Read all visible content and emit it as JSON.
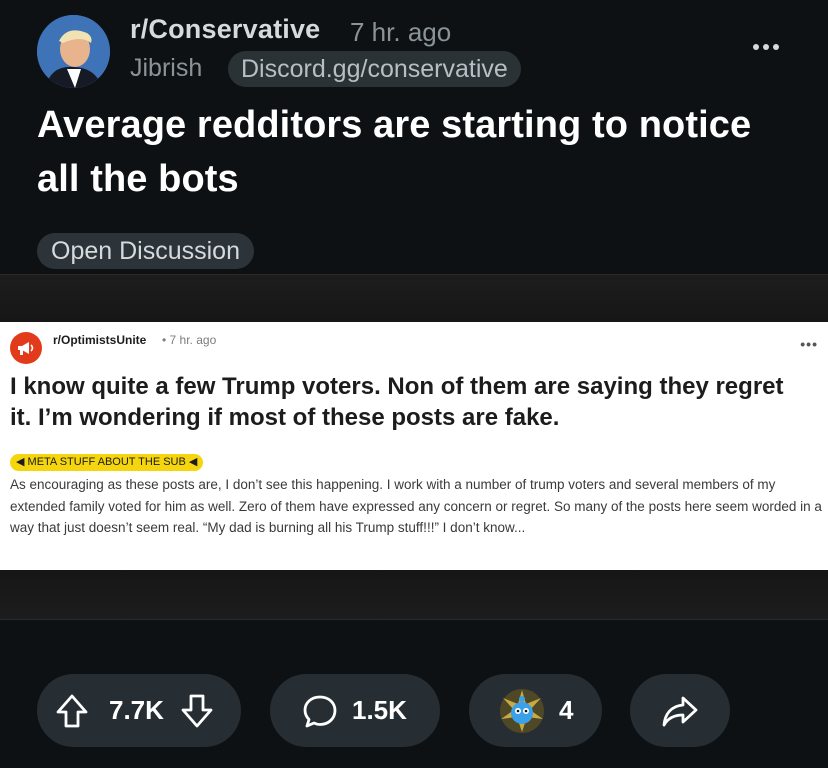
{
  "post": {
    "subreddit": "r/Conservative",
    "time": "7 hr. ago",
    "user_flair": "Jibrish",
    "user_link": "Discord.gg/conservative",
    "title": "Average redditors are starting to notice all the bots",
    "post_flair": "Open Discussion"
  },
  "image": {
    "subreddit": "r/OptimistsUnite",
    "time": "• 7 hr. ago",
    "more": "•••",
    "title": "I know quite a few Trump voters. Non of them are saying they regret it. I’m wondering if most of these posts are fake.",
    "flair": "META STUFF ABOUT THE SUB",
    "body": "As encouraging as these posts are, I don’t see this happening. I work with a number of trump voters and several members of my extended family voted for him as well. Zero of them have expressed any concern or regret. So many of the posts here seem worded in a way that just doesn’t seem real. “My dad is burning all his Trump stuff!!!” I don’t know..."
  },
  "actions": {
    "upvotes": "7.7K",
    "comments": "1.5K",
    "awards": "4"
  },
  "icons": {
    "upvote": "arrow-up-icon",
    "downvote": "arrow-down-icon",
    "comment": "comment-bubble-icon",
    "award": "award-icon",
    "share": "share-arrow-icon",
    "more": "more-dots-icon"
  },
  "colors": {
    "background": "#0e1113",
    "pill": "#262e33",
    "flair_yellow": "#f5d50d",
    "subreddit_icon": "#e23b1c"
  }
}
